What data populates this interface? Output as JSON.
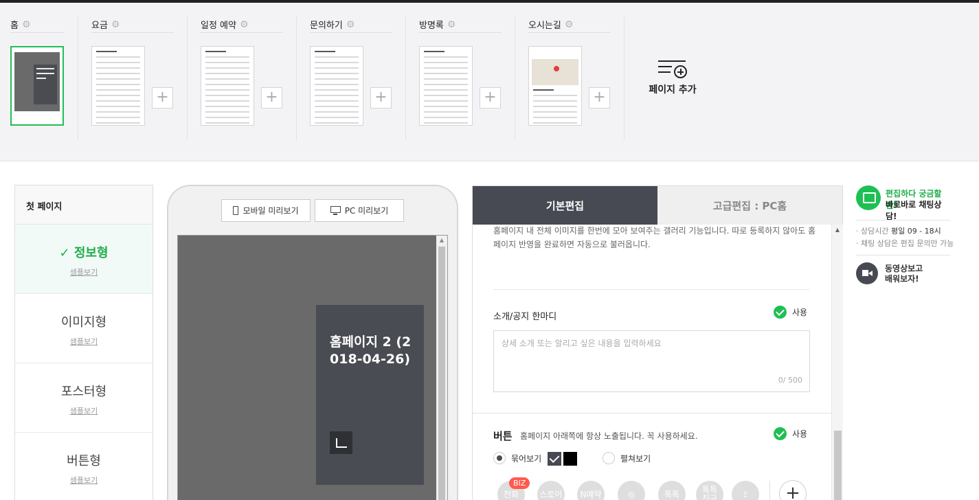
{
  "pages": [
    {
      "name": "홈"
    },
    {
      "name": "요금"
    },
    {
      "name": "일정 예약"
    },
    {
      "name": "문의하기"
    },
    {
      "name": "방명록"
    },
    {
      "name": "오시는길"
    }
  ],
  "add_page_label": "페이지 추가",
  "left": {
    "header": "첫 페이지",
    "active_check": "✓",
    "types": [
      {
        "name": "정보형",
        "sample": "샘플보기"
      },
      {
        "name": "이미지형",
        "sample": "샘플보기"
      },
      {
        "name": "포스터형",
        "sample": "샘플보기"
      },
      {
        "name": "버튼형",
        "sample": "샘플보기"
      }
    ]
  },
  "preview": {
    "mobile_label": "모바일 미리보기",
    "pc_label": "PC 미리보기",
    "hero_title": "홈페이지 2 (2018-04-26)"
  },
  "editor": {
    "tab_basic": "기본편집",
    "tab_advanced": "고급편집 : PC홈",
    "gallery_desc": "홈페이지 내 전체 이미지를 한번에 모아 보여주는 갤러리 기능입니다. 따로 등록하지 않아도 홈페이지 반영을 완료하면 자동으로 불러옵니다.",
    "intro_title": "소개/공지 한마디",
    "use_label": "사용",
    "intro_placeholder": "상세 소개 또는 알리고 싶은 내용을 입력하세요",
    "intro_counter": "0/ 500",
    "button_title": "버튼",
    "button_desc": "홈페이지 아래쪽에 항상 노출됩니다. 꼭 사용하세요.",
    "radio_grouped": "묶어보기",
    "radio_expanded": "펼쳐보기",
    "biz_badge": "BIZ",
    "circle_buttons": [
      "전화",
      "스토어",
      "N예약",
      "",
      "톡톡",
      "톡톡\n친구",
      ""
    ],
    "add_symbol": "+"
  },
  "help": {
    "chat_line1": "편집하다 궁금할땐?",
    "chat_line2": "바로바로 채팅상담!",
    "hours_label": "· 상담시간",
    "hours_value": "평일 09 - 18시",
    "note": "· 채팅 상담은 편집 문의만 가능",
    "video": "동영상보고\n배워보자!"
  },
  "colors": {
    "accent_green": "#1fbf54",
    "dark_tab": "#474a52",
    "biz_red": "#ff5a4d"
  }
}
